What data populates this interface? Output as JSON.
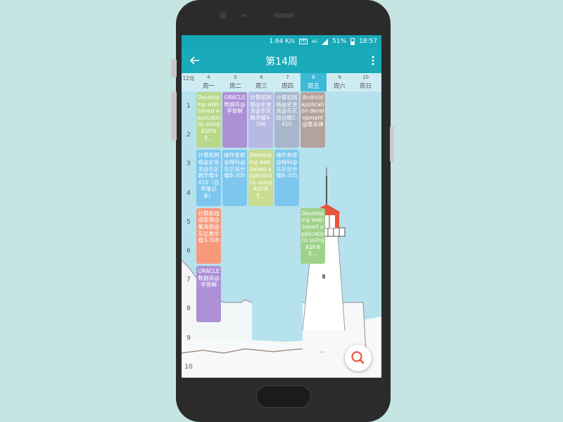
{
  "statusbar": {
    "speed": "1.64 K/s",
    "hd": "HD",
    "network": "4G",
    "battery": "51%",
    "time": "18:57"
  },
  "appbar": {
    "title": "第14周"
  },
  "month": "12月",
  "days": [
    {
      "num": "4",
      "name": "周一",
      "today": false
    },
    {
      "num": "5",
      "name": "周二",
      "today": false
    },
    {
      "num": "6",
      "name": "周三",
      "today": false
    },
    {
      "num": "7",
      "name": "周四",
      "today": false
    },
    {
      "num": "8",
      "name": "周五",
      "today": true
    },
    {
      "num": "9",
      "name": "周六",
      "today": false
    },
    {
      "num": "10",
      "name": "周日",
      "today": false
    }
  ],
  "periods": [
    "1",
    "2",
    "3",
    "4",
    "5",
    "6",
    "7",
    "8",
    "9",
    "10"
  ],
  "courses": [
    {
      "text": "Developing web-based applications using ASP.NE...",
      "day": 0,
      "start": 1,
      "span": 2,
      "color": "#b7d98b"
    },
    {
      "text": "ORACLE数据库@李俊娴",
      "day": 1,
      "start": 1,
      "span": 2,
      "color": "#ad90d6"
    },
    {
      "text": "计算机网络@史金龙@东区教学楼4-306",
      "day": 2,
      "start": 1,
      "span": 2,
      "color": "#b7b8e3"
    },
    {
      "text": "计算机网络@史金龙@东区综合楼C-410",
      "day": 3,
      "start": 1,
      "span": 2,
      "color": "#a7b6cb"
    },
    {
      "text": "Android application development@夏永锋",
      "day": 4,
      "start": 1,
      "span": 2,
      "color": "#b3a39c"
    },
    {
      "text": "计算机网络@史金龙@东区教学楼4-410（自带笔记本）",
      "day": 0,
      "start": 3,
      "span": 2,
      "color": "#7dc7ee"
    },
    {
      "text": "操作系统@程科@东区综合楼B-305",
      "day": 1,
      "start": 3,
      "span": 2,
      "color": "#7dc7ee"
    },
    {
      "text": "Developing web-based applications using ASP.NE...",
      "day": 2,
      "start": 3,
      "span": 2,
      "color": "#c8dc8f"
    },
    {
      "text": "操作系统@程科@东区综合楼B-305",
      "day": 3,
      "start": 3,
      "span": 2,
      "color": "#7dc7ee"
    },
    {
      "text": "计算机组成原理@董海燕@东区教学楼3-308",
      "day": 0,
      "start": 5,
      "span": 2,
      "color": "#f79a7c"
    },
    {
      "text": "Developing web-based applications using ASP.NE...",
      "day": 4,
      "start": 5,
      "span": 2,
      "color": "#9fd18a"
    },
    {
      "text": "ORACLE数据库@李俊娴",
      "day": 0,
      "start": 7,
      "span": 2,
      "color": "#ad90d6"
    }
  ],
  "icons": {
    "back": "arrow-back-icon",
    "more": "more-vert-icon",
    "search": "search-icon"
  },
  "colors": {
    "primary": "#19abba",
    "today": "#3cbad8",
    "fab_icon": "#e8533b"
  }
}
